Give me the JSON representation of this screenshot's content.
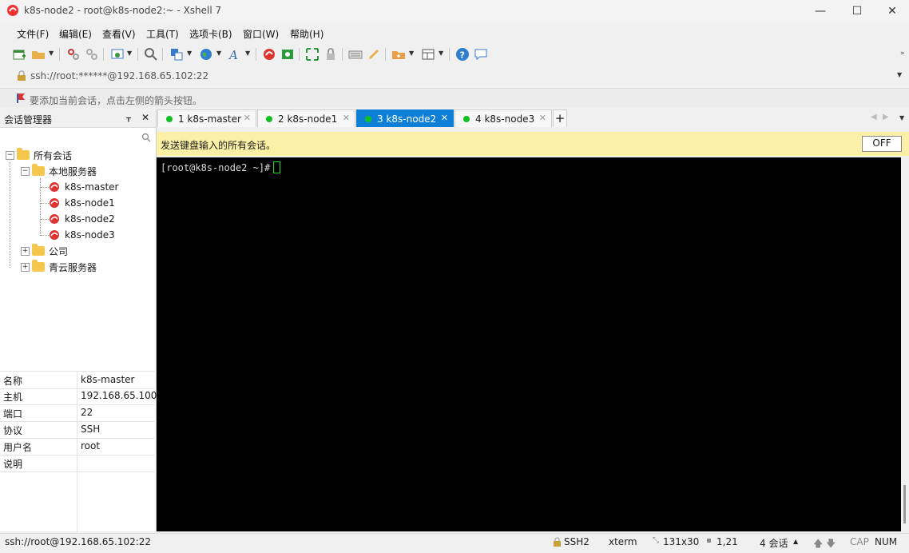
{
  "window": {
    "title": "k8s-node2 - root@k8s-node2:~ - Xshell 7",
    "minimize": "—",
    "maximize": "☐",
    "close": "✕"
  },
  "menu": [
    "文件(F)",
    "编辑(E)",
    "查看(V)",
    "工具(T)",
    "选项卡(B)",
    "窗口(W)",
    "帮助(H)"
  ],
  "address": "ssh://root:******@192.168.65.102:22",
  "hint": "要添加当前会话，点击左侧的箭头按钮。",
  "session_manager": {
    "title": "会话管理器",
    "pin": "ᚁ",
    "close": "✕",
    "root": "所有会话",
    "local_folder": "本地服务器",
    "sessions": [
      "k8s-master",
      "k8s-node1",
      "k8s-node2",
      "k8s-node3"
    ],
    "folders": [
      "公司",
      "青云服务器"
    ]
  },
  "properties": [
    {
      "key": "名称",
      "value": "k8s-master"
    },
    {
      "key": "主机",
      "value": "192.168.65.100"
    },
    {
      "key": "端口",
      "value": "22"
    },
    {
      "key": "协议",
      "value": "SSH"
    },
    {
      "key": "用户名",
      "value": "root"
    },
    {
      "key": "说明",
      "value": ""
    }
  ],
  "tabs": [
    {
      "label": "1 k8s-master",
      "active": false
    },
    {
      "label": "2 k8s-node1",
      "active": false
    },
    {
      "label": "3 k8s-node2",
      "active": true
    },
    {
      "label": "4 k8s-node3",
      "active": false
    }
  ],
  "add_tab": "+",
  "send_all": {
    "text": "发送键盘输入的所有会话。",
    "button": "OFF"
  },
  "terminal": {
    "prompt": "[root@k8s-node2 ~]#"
  },
  "status": {
    "connection": "ssh://root@192.168.65.102:22",
    "protocol": "SSH2",
    "term": "xterm",
    "size": "131x30",
    "position": "1,21",
    "sessions": "4 会话",
    "cap": "CAP",
    "num": "NUM"
  },
  "colors": {
    "active_tab": "#0e7fd6",
    "status_dot": "#10c020",
    "send_bar": "#fbf0a6",
    "terminal_bg": "#000000"
  }
}
